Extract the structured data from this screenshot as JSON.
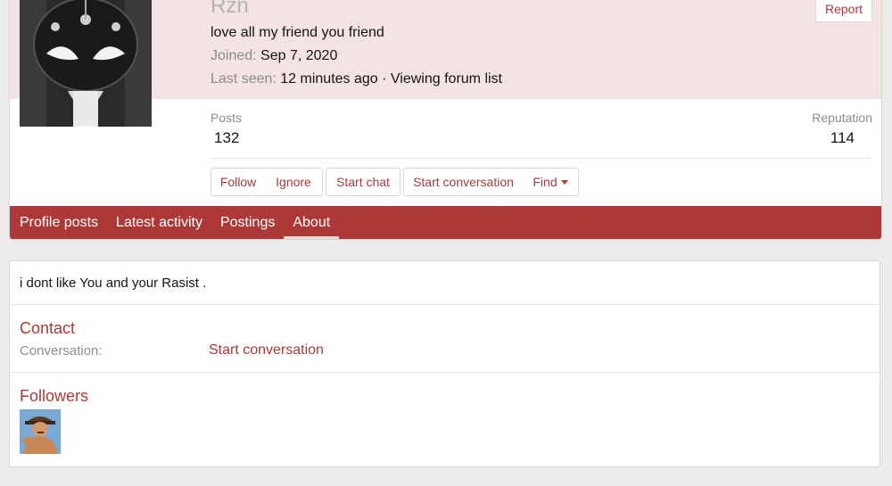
{
  "profile": {
    "username": "Rzn",
    "status": "love all my friend you friend",
    "joined_label": "Joined:",
    "joined_value": "Sep 7, 2020",
    "last_seen_label": "Last seen:",
    "last_seen_value": "12 minutes ago · Viewing forum list",
    "report_label": "Report",
    "stats": {
      "posts_label": "Posts",
      "posts_value": "132",
      "reputation_label": "Reputation",
      "reputation_value": "114"
    },
    "actions": {
      "follow": "Follow",
      "ignore": "Ignore",
      "start_chat": "Start chat",
      "start_conversation": "Start conversation",
      "find": "Find"
    }
  },
  "tabs": [
    {
      "label": "Profile posts"
    },
    {
      "label": "Latest activity"
    },
    {
      "label": "Postings"
    },
    {
      "label": "About",
      "active": true
    }
  ],
  "about": {
    "text": "i dont like You and your Rasist .",
    "contact_title": "Contact",
    "conversation_label": "Conversation:",
    "conversation_link": "Start conversation",
    "followers_title": "Followers"
  },
  "colors": {
    "accent": "#ad3838",
    "banner": "#f3e3e3",
    "link": "#a83b3b"
  },
  "icons": {
    "find_caret": "caret-down-icon"
  }
}
